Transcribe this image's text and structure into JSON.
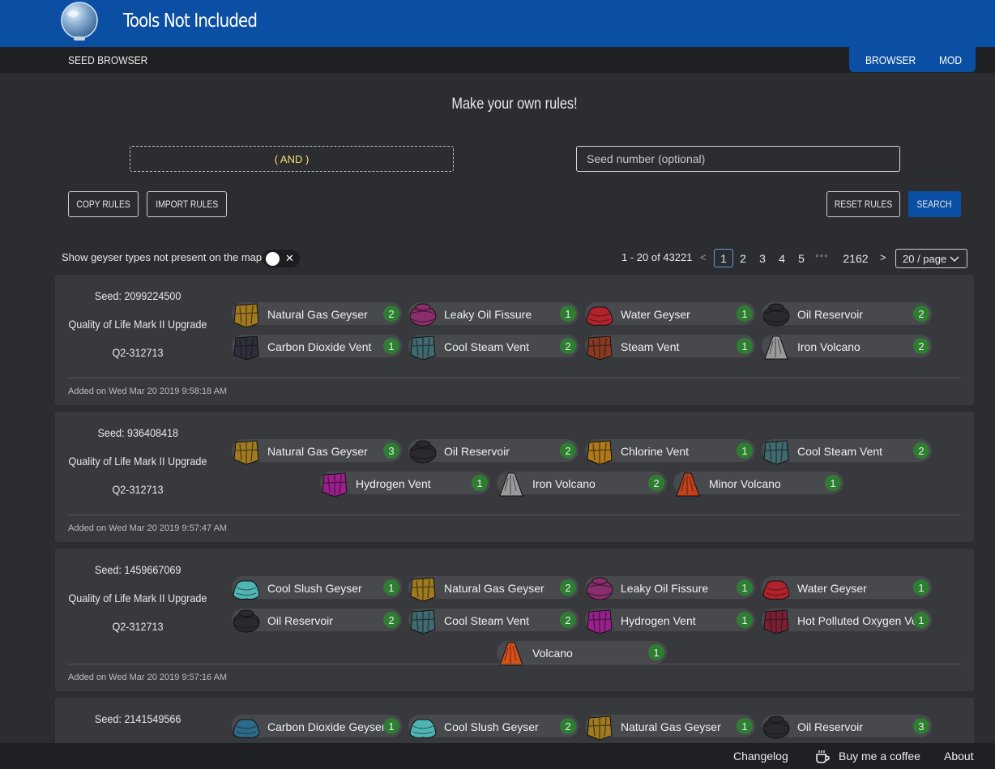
{
  "app": {
    "title": "Tools Not Included"
  },
  "subnav": {
    "title": "SEED BROWSER",
    "links": [
      "BROWSER",
      "MOD"
    ]
  },
  "rules": {
    "headline": "Make your own rules!",
    "and_label": "( AND )",
    "seed_placeholder": "Seed number (optional)",
    "copy_label": "COPY RULES",
    "import_label": "IMPORT RULES",
    "reset_label": "RESET RULES",
    "search_label": "SEARCH"
  },
  "filter": {
    "label": "Show geyser types not present on the map",
    "toggle_symbol": "✕",
    "enabled": false
  },
  "pagination": {
    "total": "1 - 20 of 43221",
    "pages": [
      "1",
      "2",
      "3",
      "4",
      "5"
    ],
    "dots": "•••",
    "last_page": "2162",
    "prev": "<",
    "next": ">",
    "page_size": "20 / page",
    "current": "1"
  },
  "seeds": [
    {
      "seed": "Seed: 2099224500",
      "version": "Quality of Life Mark II Upgrade",
      "build": "Q2-312713",
      "added": "Added on Wed Mar 20 2019 9:58:18 AM",
      "geysers": [
        {
          "name": "Natural Gas Geyser",
          "count": "2",
          "icon": "natural-gas-geyser-icon",
          "color": "#a07a1e"
        },
        {
          "name": "Leaky Oil Fissure",
          "count": "1",
          "icon": "leaky-oil-fissure-icon",
          "color": "#8a2d6d"
        },
        {
          "name": "Water Geyser",
          "count": "1",
          "icon": "water-geyser-icon",
          "color": "#b2222a"
        },
        {
          "name": "Oil Reservoir",
          "count": "2",
          "icon": "oil-reservoir-icon",
          "color": "#2a2a2e"
        },
        {
          "name": "Carbon Dioxide Vent",
          "count": "1",
          "icon": "carbon-dioxide-vent-icon",
          "color": "#2e2e3c"
        },
        {
          "name": "Cool Steam Vent",
          "count": "2",
          "icon": "cool-steam-vent-icon",
          "color": "#3f6a70"
        },
        {
          "name": "Steam Vent",
          "count": "1",
          "icon": "steam-vent-icon",
          "color": "#8a3a22"
        },
        {
          "name": "Iron Volcano",
          "count": "2",
          "icon": "iron-volcano-icon",
          "color": "#9a9a9a"
        }
      ]
    },
    {
      "seed": "Seed: 936408418",
      "version": "Quality of Life Mark II Upgrade",
      "build": "Q2-312713",
      "added": "Added on Wed Mar 20 2019 9:57:47 AM",
      "geysers": [
        {
          "name": "Natural Gas Geyser",
          "count": "3",
          "icon": "natural-gas-geyser-icon",
          "color": "#a07a1e"
        },
        {
          "name": "Oil Reservoir",
          "count": "2",
          "icon": "oil-reservoir-icon",
          "color": "#2a2a2e"
        },
        {
          "name": "Chlorine Vent",
          "count": "1",
          "icon": "chlorine-vent-icon",
          "color": "#b07a1a"
        },
        {
          "name": "Cool Steam Vent",
          "count": "2",
          "icon": "cool-steam-vent-icon",
          "color": "#3f6a70"
        },
        {
          "name": "Hydrogen Vent",
          "count": "1",
          "icon": "hydrogen-vent-icon",
          "color": "#9a1f8c"
        },
        {
          "name": "Iron Volcano",
          "count": "2",
          "icon": "iron-volcano-icon",
          "color": "#9a9a9a"
        },
        {
          "name": "Minor Volcano",
          "count": "1",
          "icon": "minor-volcano-icon",
          "color": "#c2401a"
        }
      ]
    },
    {
      "seed": "Seed: 1459667069",
      "version": "Quality of Life Mark II Upgrade",
      "build": "Q2-312713",
      "added": "Added on Wed Mar 20 2019 9:57:16 AM",
      "geysers": [
        {
          "name": "Cool Slush Geyser",
          "count": "1",
          "icon": "cool-slush-geyser-icon",
          "color": "#4fb4b4"
        },
        {
          "name": "Natural Gas Geyser",
          "count": "2",
          "icon": "natural-gas-geyser-icon",
          "color": "#a07a1e"
        },
        {
          "name": "Leaky Oil Fissure",
          "count": "1",
          "icon": "leaky-oil-fissure-icon",
          "color": "#8a2d6d"
        },
        {
          "name": "Water Geyser",
          "count": "1",
          "icon": "water-geyser-icon",
          "color": "#b2222a"
        },
        {
          "name": "Oil Reservoir",
          "count": "2",
          "icon": "oil-reservoir-icon",
          "color": "#2a2a2e"
        },
        {
          "name": "Cool Steam Vent",
          "count": "2",
          "icon": "cool-steam-vent-icon",
          "color": "#3f6a70"
        },
        {
          "name": "Hydrogen Vent",
          "count": "1",
          "icon": "hydrogen-vent-icon",
          "color": "#9a1f8c"
        },
        {
          "name": "Hot Polluted Oxygen Vent",
          "count": "1",
          "icon": "hot-polluted-oxygen-vent-icon",
          "color": "#7a1f33"
        },
        {
          "name": "Volcano",
          "count": "1",
          "icon": "volcano-icon",
          "color": "#d8501a"
        }
      ]
    },
    {
      "seed": "Seed: 2141549566",
      "version": "",
      "build": "",
      "added": "",
      "geysers": [
        {
          "name": "Carbon Dioxide Geyser",
          "count": "1",
          "icon": "carbon-dioxide-geyser-icon",
          "color": "#2d6a8a"
        },
        {
          "name": "Cool Slush Geyser",
          "count": "2",
          "icon": "cool-slush-geyser-icon",
          "color": "#4fb4b4"
        },
        {
          "name": "Natural Gas Geyser",
          "count": "1",
          "icon": "natural-gas-geyser-icon",
          "color": "#a07a1e"
        },
        {
          "name": "Oil Reservoir",
          "count": "3",
          "icon": "oil-reservoir-icon",
          "color": "#2a2a2e"
        }
      ]
    }
  ],
  "footer": {
    "changelog": "Changelog",
    "coffee": "Buy me a coffee",
    "about": "About"
  },
  "colors": {
    "brand": "#0a4fa3",
    "background": "#2b2d31",
    "card": "#38393d",
    "pill": "#48494d",
    "count_badge": "#2f7d32"
  }
}
